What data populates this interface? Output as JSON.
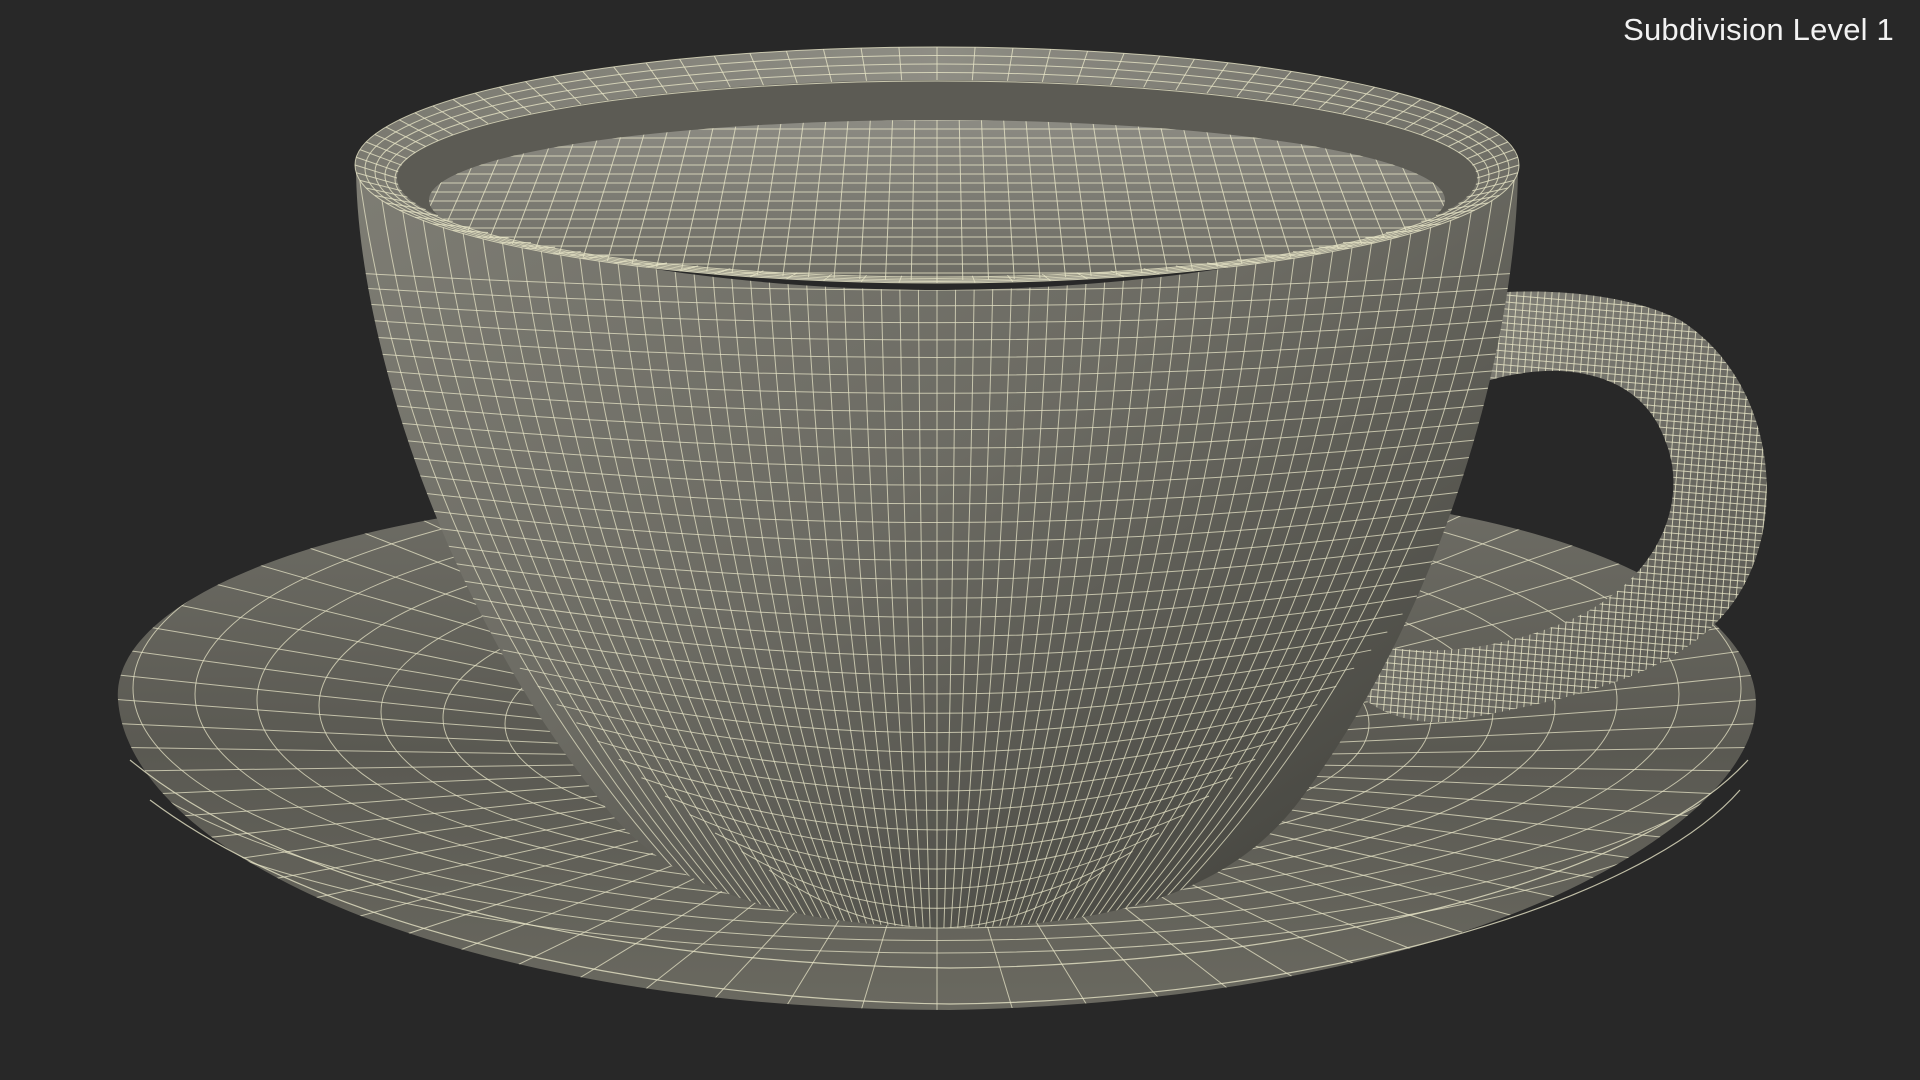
{
  "viewport": {
    "label": "Subdivision Level 1"
  },
  "render": {
    "background": "#282828",
    "surface_light": "#8a8a82",
    "surface_dark": "#4a4a44",
    "wire": "#e6e3c6"
  }
}
